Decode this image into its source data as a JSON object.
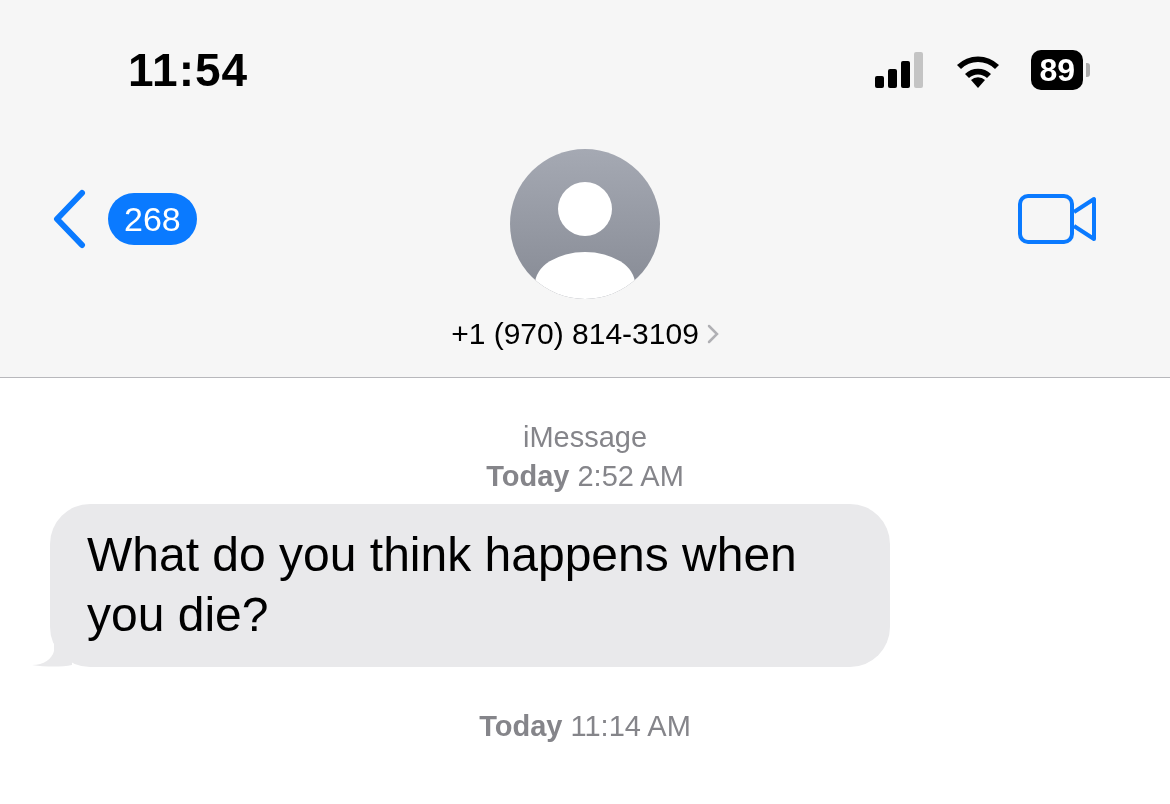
{
  "status_bar": {
    "time": "11:54",
    "battery": "89"
  },
  "header": {
    "back_count": "268",
    "contact": "+1 (970) 814-3109"
  },
  "messages": [
    {
      "kind": "service",
      "text": "iMessage"
    },
    {
      "kind": "timestamp",
      "text": "**Today** 2:52 AM"
    },
    {
      "kind": "incoming",
      "text": "What do you think happens when you die?"
    },
    {
      "kind": "timestamp",
      "text": "**Today** 11:14 AM"
    }
  ]
}
